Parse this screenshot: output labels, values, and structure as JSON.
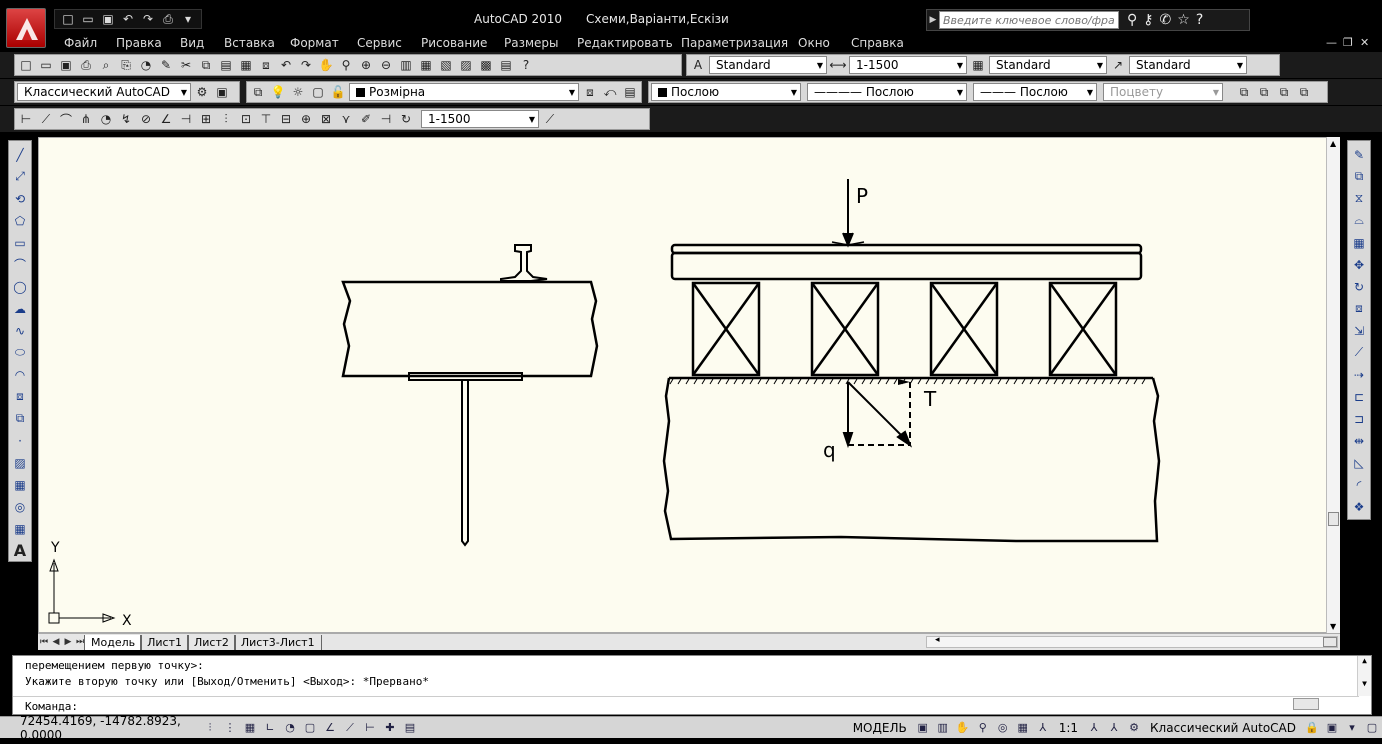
{
  "window": {
    "app_name": "AutoCAD 2010",
    "document_name": "Схеми,Варіанти,Ескізи"
  },
  "search": {
    "placeholder": "Введите ключевое слово/фразу"
  },
  "menu": [
    "Файл",
    "Правка",
    "Вид",
    "Вставка",
    "Формат",
    "Сервис",
    "Рисование",
    "Размеры",
    "Редактировать",
    "Параметризация",
    "Окно",
    "Справка"
  ],
  "styles_toolbar": {
    "text_style": "Standard",
    "dim_style": "1-1500",
    "table_style": "Standard",
    "mleader_style": "Standard"
  },
  "workspace": {
    "name": "Классический AutoCAD"
  },
  "layers_toolbar": {
    "current_layer": "Розмірна",
    "color": "Послою",
    "linetype": "Послою",
    "lineweight": "Послою",
    "plot_style": "Поцвету"
  },
  "dim_toolbar": {
    "dim_style": "1-1500"
  },
  "drawing": {
    "label_P": "P",
    "label_T": "T",
    "label_q": "q",
    "ucs_x": "X",
    "ucs_y": "Y"
  },
  "layout_tabs": [
    "Модель",
    "Лист1",
    "Лист2",
    "Лист3-Лист1"
  ],
  "command_line": {
    "history_1": "перемещением первую точку>:",
    "history_2": "Укажите вторую точку или [Выход/Отменить] <Выход>: *Прервано*",
    "prompt": "Команда:"
  },
  "status_bar": {
    "coordinates": "72454.4169, -14782.8923, 0.0000",
    "space": "МОДЕЛЬ",
    "annotation_scale": "1:1",
    "workspace": "Классический AutoCAD"
  },
  "colors": {
    "canvas_bg": "#fdfcf0",
    "chrome_bg": "#000000",
    "toolbar_bg": "#d9d9d9",
    "layer_color_swatch": "#000000"
  }
}
